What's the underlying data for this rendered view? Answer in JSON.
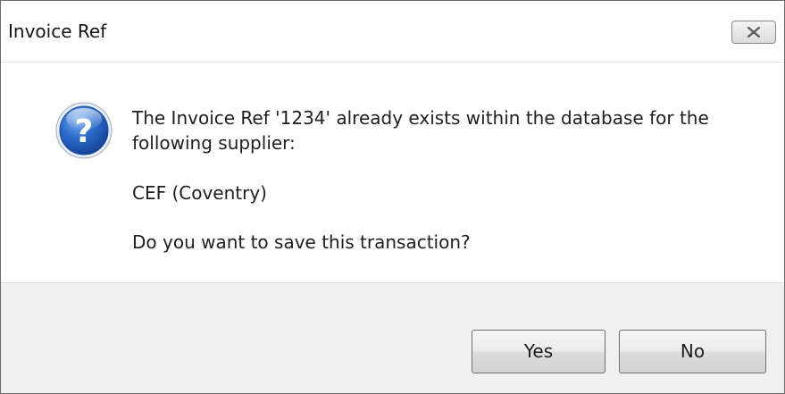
{
  "dialog": {
    "title": "Invoice Ref",
    "close_icon": "close-icon",
    "message_icon": "question-icon",
    "message": {
      "line1": "The Invoice Ref '1234' already exists within the database for the",
      "line2": "following supplier:",
      "supplier": "CEF (Coventry)",
      "question": "Do you want to save this transaction?"
    },
    "buttons": {
      "yes_label": "Yes",
      "no_label": "No"
    }
  }
}
